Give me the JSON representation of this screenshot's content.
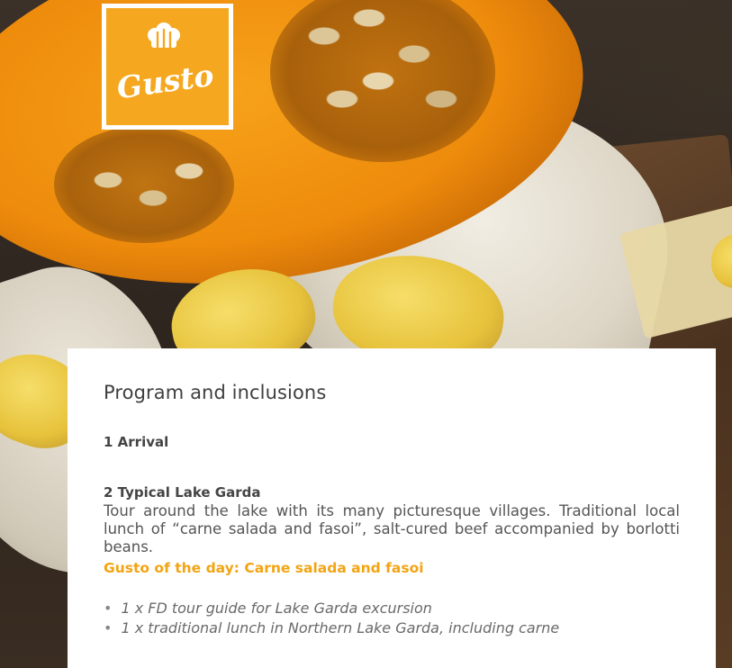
{
  "brand": {
    "logo_text": "Gusto",
    "logo_bg_color": "#f5a81f",
    "icon": "chef-hat-cutlery-icon"
  },
  "program": {
    "title": "Program and inclusions",
    "days": [
      {
        "label": "1 Arrival"
      },
      {
        "label": "2 Typical Lake Garda",
        "description": "Tour around the lake with its many picturesque villages. Traditional local lunch of “carne salada and fasoi”, salt-cured beef accompanied by borlotti beans.",
        "gusto_of_the_day": "Gusto of the day: Carne salada and fasoi",
        "inclusions": [
          "1 x FD tour guide for Lake Garda excursion",
          "1 x traditional lunch in Northern Lake Garda, including carne"
        ]
      }
    ]
  },
  "colors": {
    "accent": "#f2a413",
    "text": "#555555",
    "heading": "#3f3f3f"
  }
}
